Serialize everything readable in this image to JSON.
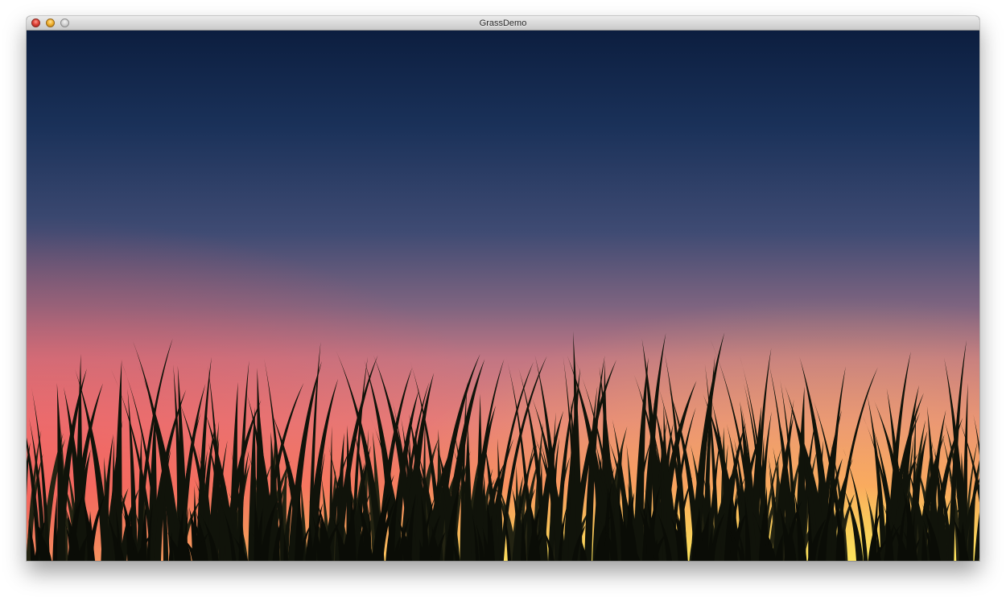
{
  "window": {
    "title": "GrassDemo"
  },
  "controls": {
    "close": "close-button",
    "minimize": "minimize-button",
    "zoom": "zoom-button"
  },
  "scene": {
    "sky_colors": [
      "#0c1e3f",
      "#1a3159",
      "#3f4b73",
      "#7e6480",
      "#c27683",
      "#e5807a",
      "#f7865f",
      "#f6b857",
      "#fde45d"
    ],
    "left_glow_color": "#f2585f",
    "grass_color": "#10130a"
  }
}
